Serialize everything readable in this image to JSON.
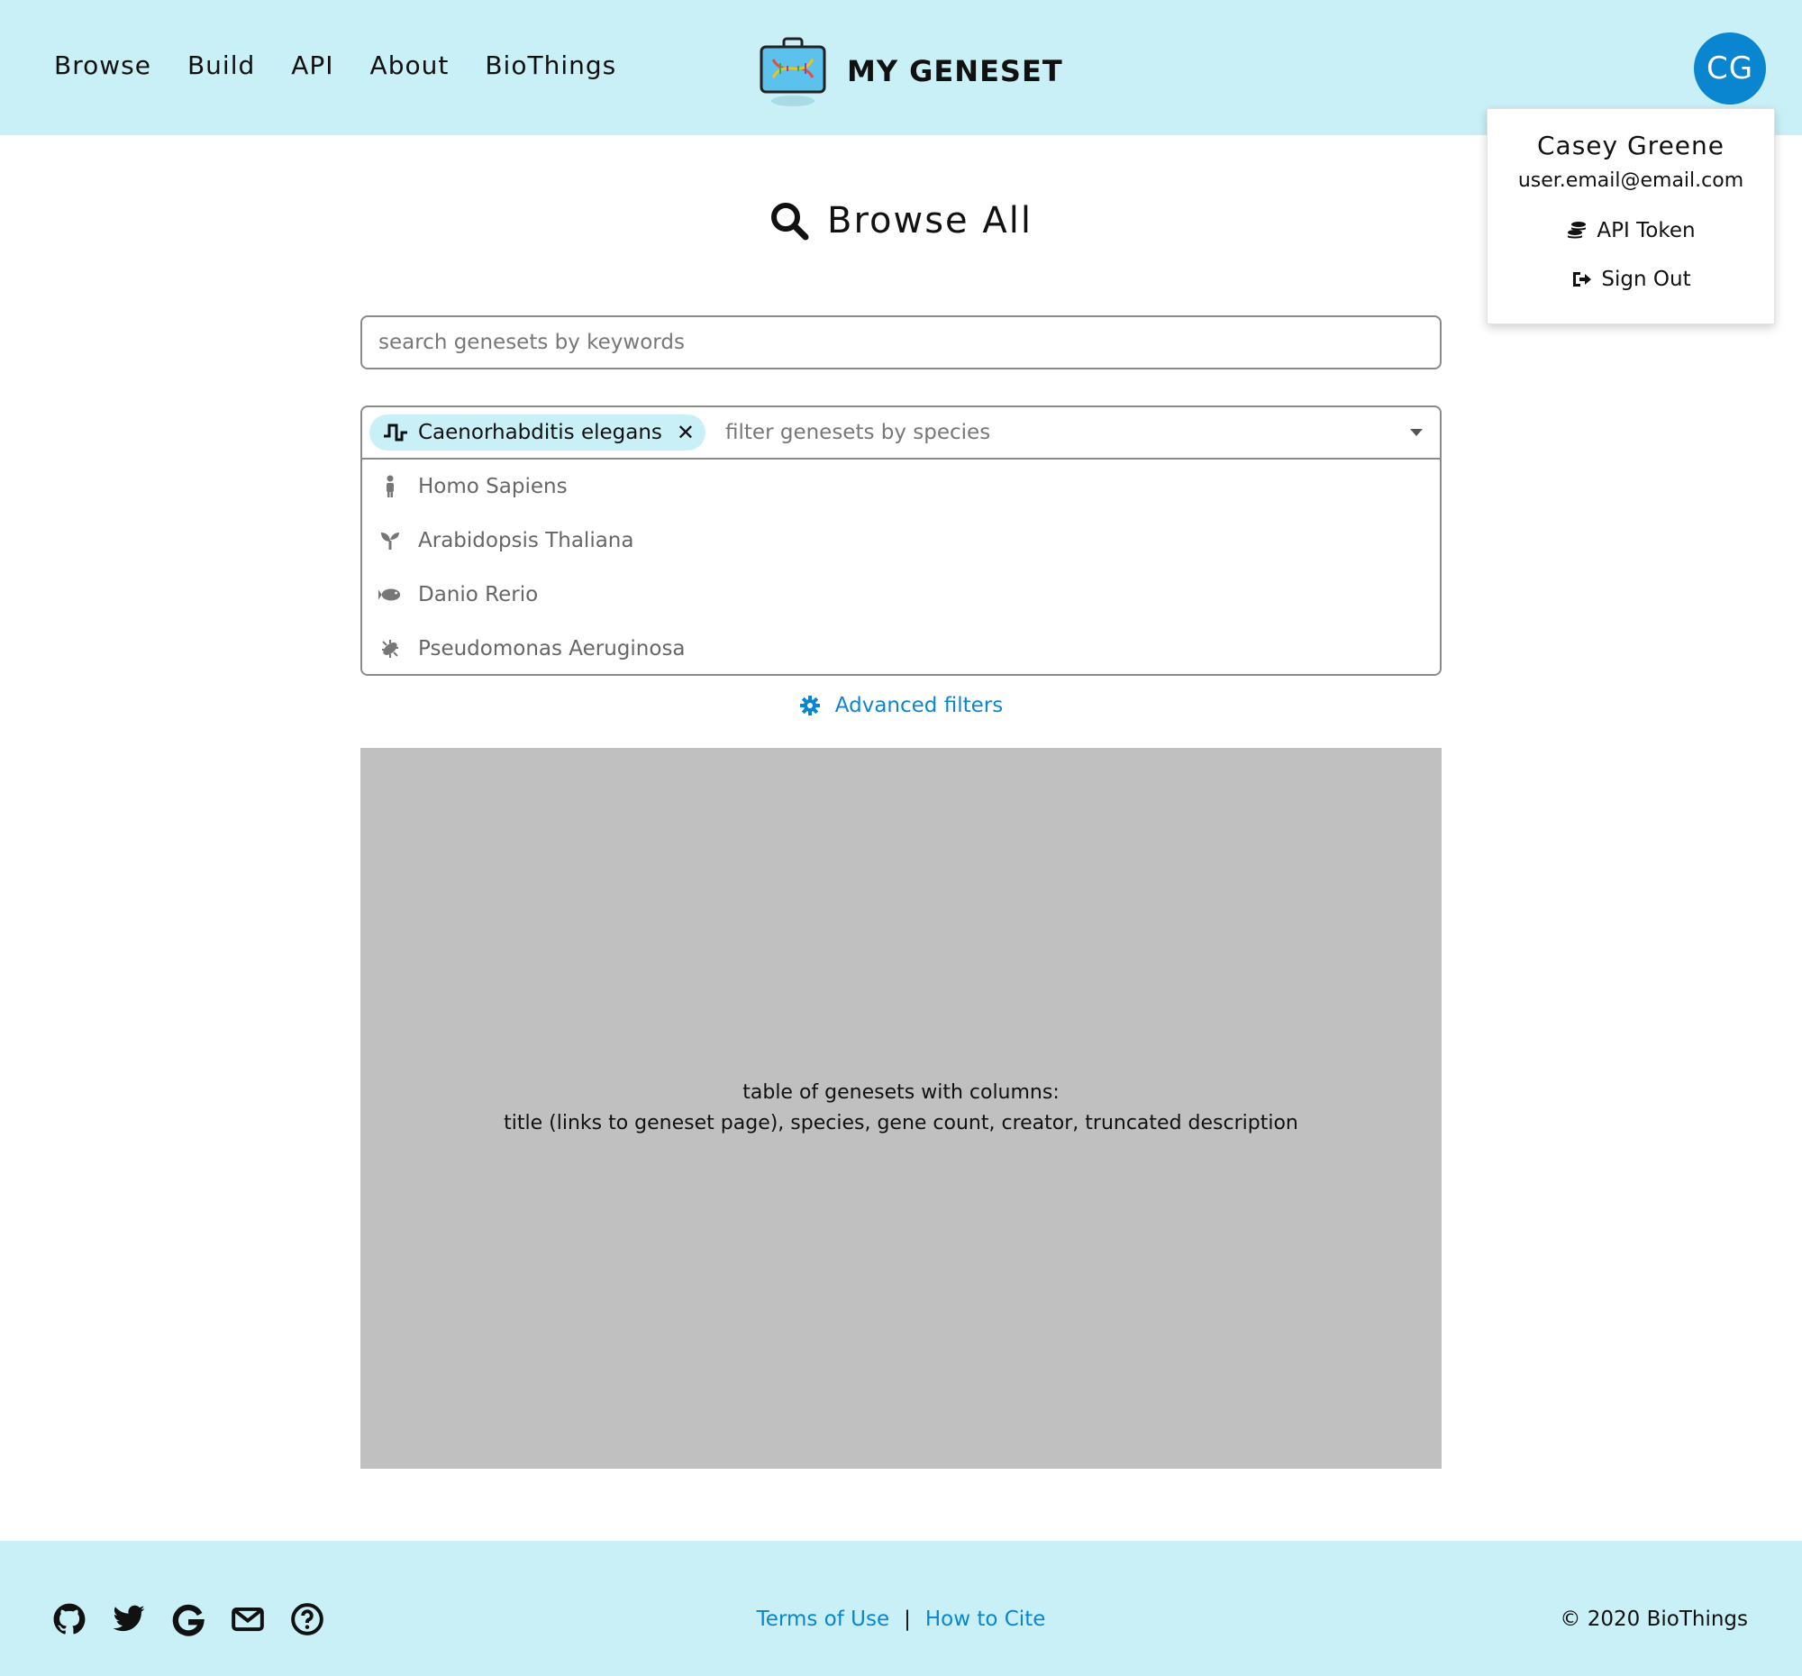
{
  "header": {
    "nav": [
      "Browse",
      "Build",
      "API",
      "About",
      "BioThings"
    ],
    "brand": "MY GENESET",
    "avatar_initials": "CG"
  },
  "user_menu": {
    "name": "Casey Greene",
    "email": "user.email@email.com",
    "api_token": "API Token",
    "sign_out": "Sign Out"
  },
  "page": {
    "title": "Browse All"
  },
  "search": {
    "placeholder": "search genesets by keywords"
  },
  "species": {
    "selected": "Caenorhabditis elegans",
    "placeholder": "filter genesets by species",
    "options": [
      {
        "label": "Homo Sapiens",
        "icon": "person-icon"
      },
      {
        "label": "Arabidopsis Thaliana",
        "icon": "seedling-icon"
      },
      {
        "label": "Danio Rerio",
        "icon": "fish-icon"
      },
      {
        "label": "Pseudomonas Aeruginosa",
        "icon": "bacterium-icon"
      }
    ]
  },
  "advanced_filters": "Advanced filters",
  "table_placeholder": {
    "line1": "table of genesets with columns:",
    "line2": "title (links to geneset page), species, gene count, creator, truncated description"
  },
  "footer": {
    "terms": "Terms of Use",
    "separator": "|",
    "cite": "How to Cite",
    "copyright": "© 2020 BioThings"
  },
  "colors": {
    "header_bg": "#c9eff7",
    "accent": "#0a86d0",
    "placeholder_gray": "#c0c0c0"
  }
}
